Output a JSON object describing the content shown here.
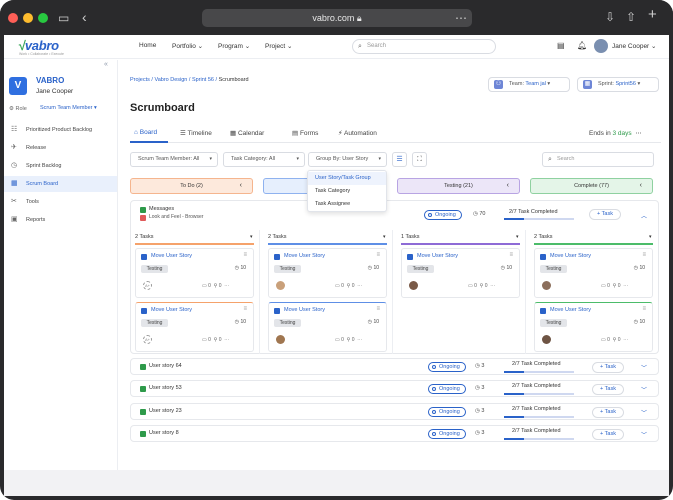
{
  "browser": {
    "url": "vabro.com"
  },
  "brand": {
    "logo": "vabro",
    "tagline": "Work • Collaborate • Execute"
  },
  "topnav": {
    "items": [
      "Home",
      "Portfolio",
      "Program",
      "Project"
    ],
    "search_placeholder": "Search",
    "user": "Jane Cooper"
  },
  "sidebar": {
    "project_initial": "V",
    "project_name": "VABRO",
    "project_user": "Jane Cooper",
    "role_label": "Role",
    "role_value": "Scrum Team Member",
    "items": [
      {
        "label": "Prioritized Product Backlog",
        "icon": "backlog-icon"
      },
      {
        "label": "Release",
        "icon": "rocket-icon"
      },
      {
        "label": "Sprint Backlog",
        "icon": "sprint-icon"
      },
      {
        "label": "Scrum Board",
        "icon": "board-icon"
      },
      {
        "label": "Tools",
        "icon": "tools-icon"
      },
      {
        "label": "Reports",
        "icon": "reports-icon"
      }
    ],
    "active_index": 3
  },
  "breadcrumb": {
    "path": "Projects / Vabro Design / Sprint 56 / ",
    "current": "Scrumboard"
  },
  "page_title": "Scrumboard",
  "team": {
    "label": "Team:",
    "value": "Team jal"
  },
  "sprint": {
    "label": "Sprint:",
    "value": "Sprint56"
  },
  "tabs": [
    "Board",
    "Timeline",
    "Calendar",
    "Forms",
    "Automation"
  ],
  "ends": {
    "prefix": "Ends in",
    "value": "3 days"
  },
  "filters": {
    "member": "Scrum Team Member: All",
    "category": "Task Category: All",
    "groupby": "Group By: User Story",
    "search_placeholder": "Search"
  },
  "groupby_menu": [
    "User Story/Task Group",
    "Task Category",
    "Task Assignee"
  ],
  "status_columns": [
    {
      "label": "To Do (2)",
      "color": "#fde9dc",
      "border": "#f5b58e"
    },
    {
      "label": "In",
      "color": "#e6effd",
      "border": "#8fb2ef"
    },
    {
      "label": "Testing (21)",
      "color": "#ece6f8",
      "border": "#b8a4e3"
    },
    {
      "label": "Complete (77)",
      "color": "#e4f5e8",
      "border": "#8fd1a0"
    }
  ],
  "story_main": {
    "title": "Messages",
    "sub": "Look and Feel - Browser",
    "status": "Ongoing",
    "count": "70",
    "completed": "2/7 Task Completed",
    "progress": 0.29,
    "add": "+ Task"
  },
  "columns": [
    {
      "head": "2 Tasks",
      "bar": "#f5a26b",
      "cards": [
        {
          "title": "Move User Story",
          "tag": "Testing",
          "num": "10",
          "comments": "0",
          "links": "0",
          "avatar": "A+"
        },
        {
          "title": "Move User Story",
          "tag": "Testing",
          "num": "10",
          "comments": "0",
          "links": "0",
          "avatar": "A+"
        }
      ]
    },
    {
      "head": "2 Tasks",
      "bar": "#5e8fe6",
      "cards": [
        {
          "title": "Move User Story",
          "tag": "Testing",
          "num": "10",
          "comments": "0",
          "links": "0",
          "avatar": ""
        },
        {
          "title": "Move User Story",
          "tag": "Testing",
          "num": "10",
          "comments": "0",
          "links": "0",
          "avatar": ""
        }
      ]
    },
    {
      "head": "1 Tasks",
      "bar": "#8e6bd6",
      "cards": [
        {
          "title": "Move User Story",
          "tag": "Testing",
          "num": "10",
          "comments": "0",
          "links": "0",
          "avatar": ""
        }
      ]
    },
    {
      "head": "2 Tasks",
      "bar": "#4cbc6a",
      "cards": [
        {
          "title": "Move User Story",
          "tag": "Testing",
          "num": "10",
          "comments": "0",
          "links": "0",
          "avatar": ""
        },
        {
          "title": "Move User Story",
          "tag": "Testing",
          "num": "10",
          "comments": "0",
          "links": "0",
          "avatar": ""
        }
      ]
    }
  ],
  "stories": [
    {
      "title": "User story 64",
      "status": "Ongoing",
      "count": "3",
      "completed": "2/7 Task Completed",
      "add": "+ Task"
    },
    {
      "title": "User story 53",
      "status": "Ongoing",
      "count": "3",
      "completed": "2/7 Task Completed",
      "add": "+ Task"
    },
    {
      "title": "User story 23",
      "status": "Ongoing",
      "count": "3",
      "completed": "2/7 Task Completed",
      "add": "+ Task"
    },
    {
      "title": "User story 8",
      "status": "Ongoing",
      "count": "3",
      "completed": "2/7 Task Completed",
      "add": "+ Task"
    }
  ]
}
